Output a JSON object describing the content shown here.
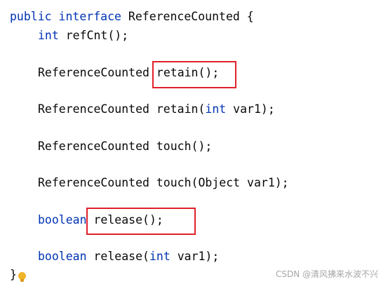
{
  "editor": {
    "line1": {
      "kw1": "public",
      "kw2": "interface",
      "rest": " ReferenceCounted {"
    },
    "line2": {
      "kw": "int",
      "rest": " refCnt();"
    },
    "line3": {
      "type": "ReferenceCounted",
      "method": "retain();"
    },
    "line4": {
      "prefix": "ReferenceCounted retain(",
      "kw": "int",
      "suffix": " var1);"
    },
    "line5": {
      "text": "ReferenceCounted touch();"
    },
    "line6": {
      "text": "ReferenceCounted touch(Object var1);"
    },
    "line7": {
      "kw": "boolean",
      "method": "release();"
    },
    "line8": {
      "kw": "boolean",
      "prefix": " release(",
      "kw2": "int",
      "suffix": " var1);"
    },
    "closing_brace": "}"
  },
  "highlight_color": "#e0202a",
  "keyword_color": "#0033b3",
  "intention_icon": "lightbulb-icon",
  "watermark": "CSDN @清风拂来水波不兴"
}
